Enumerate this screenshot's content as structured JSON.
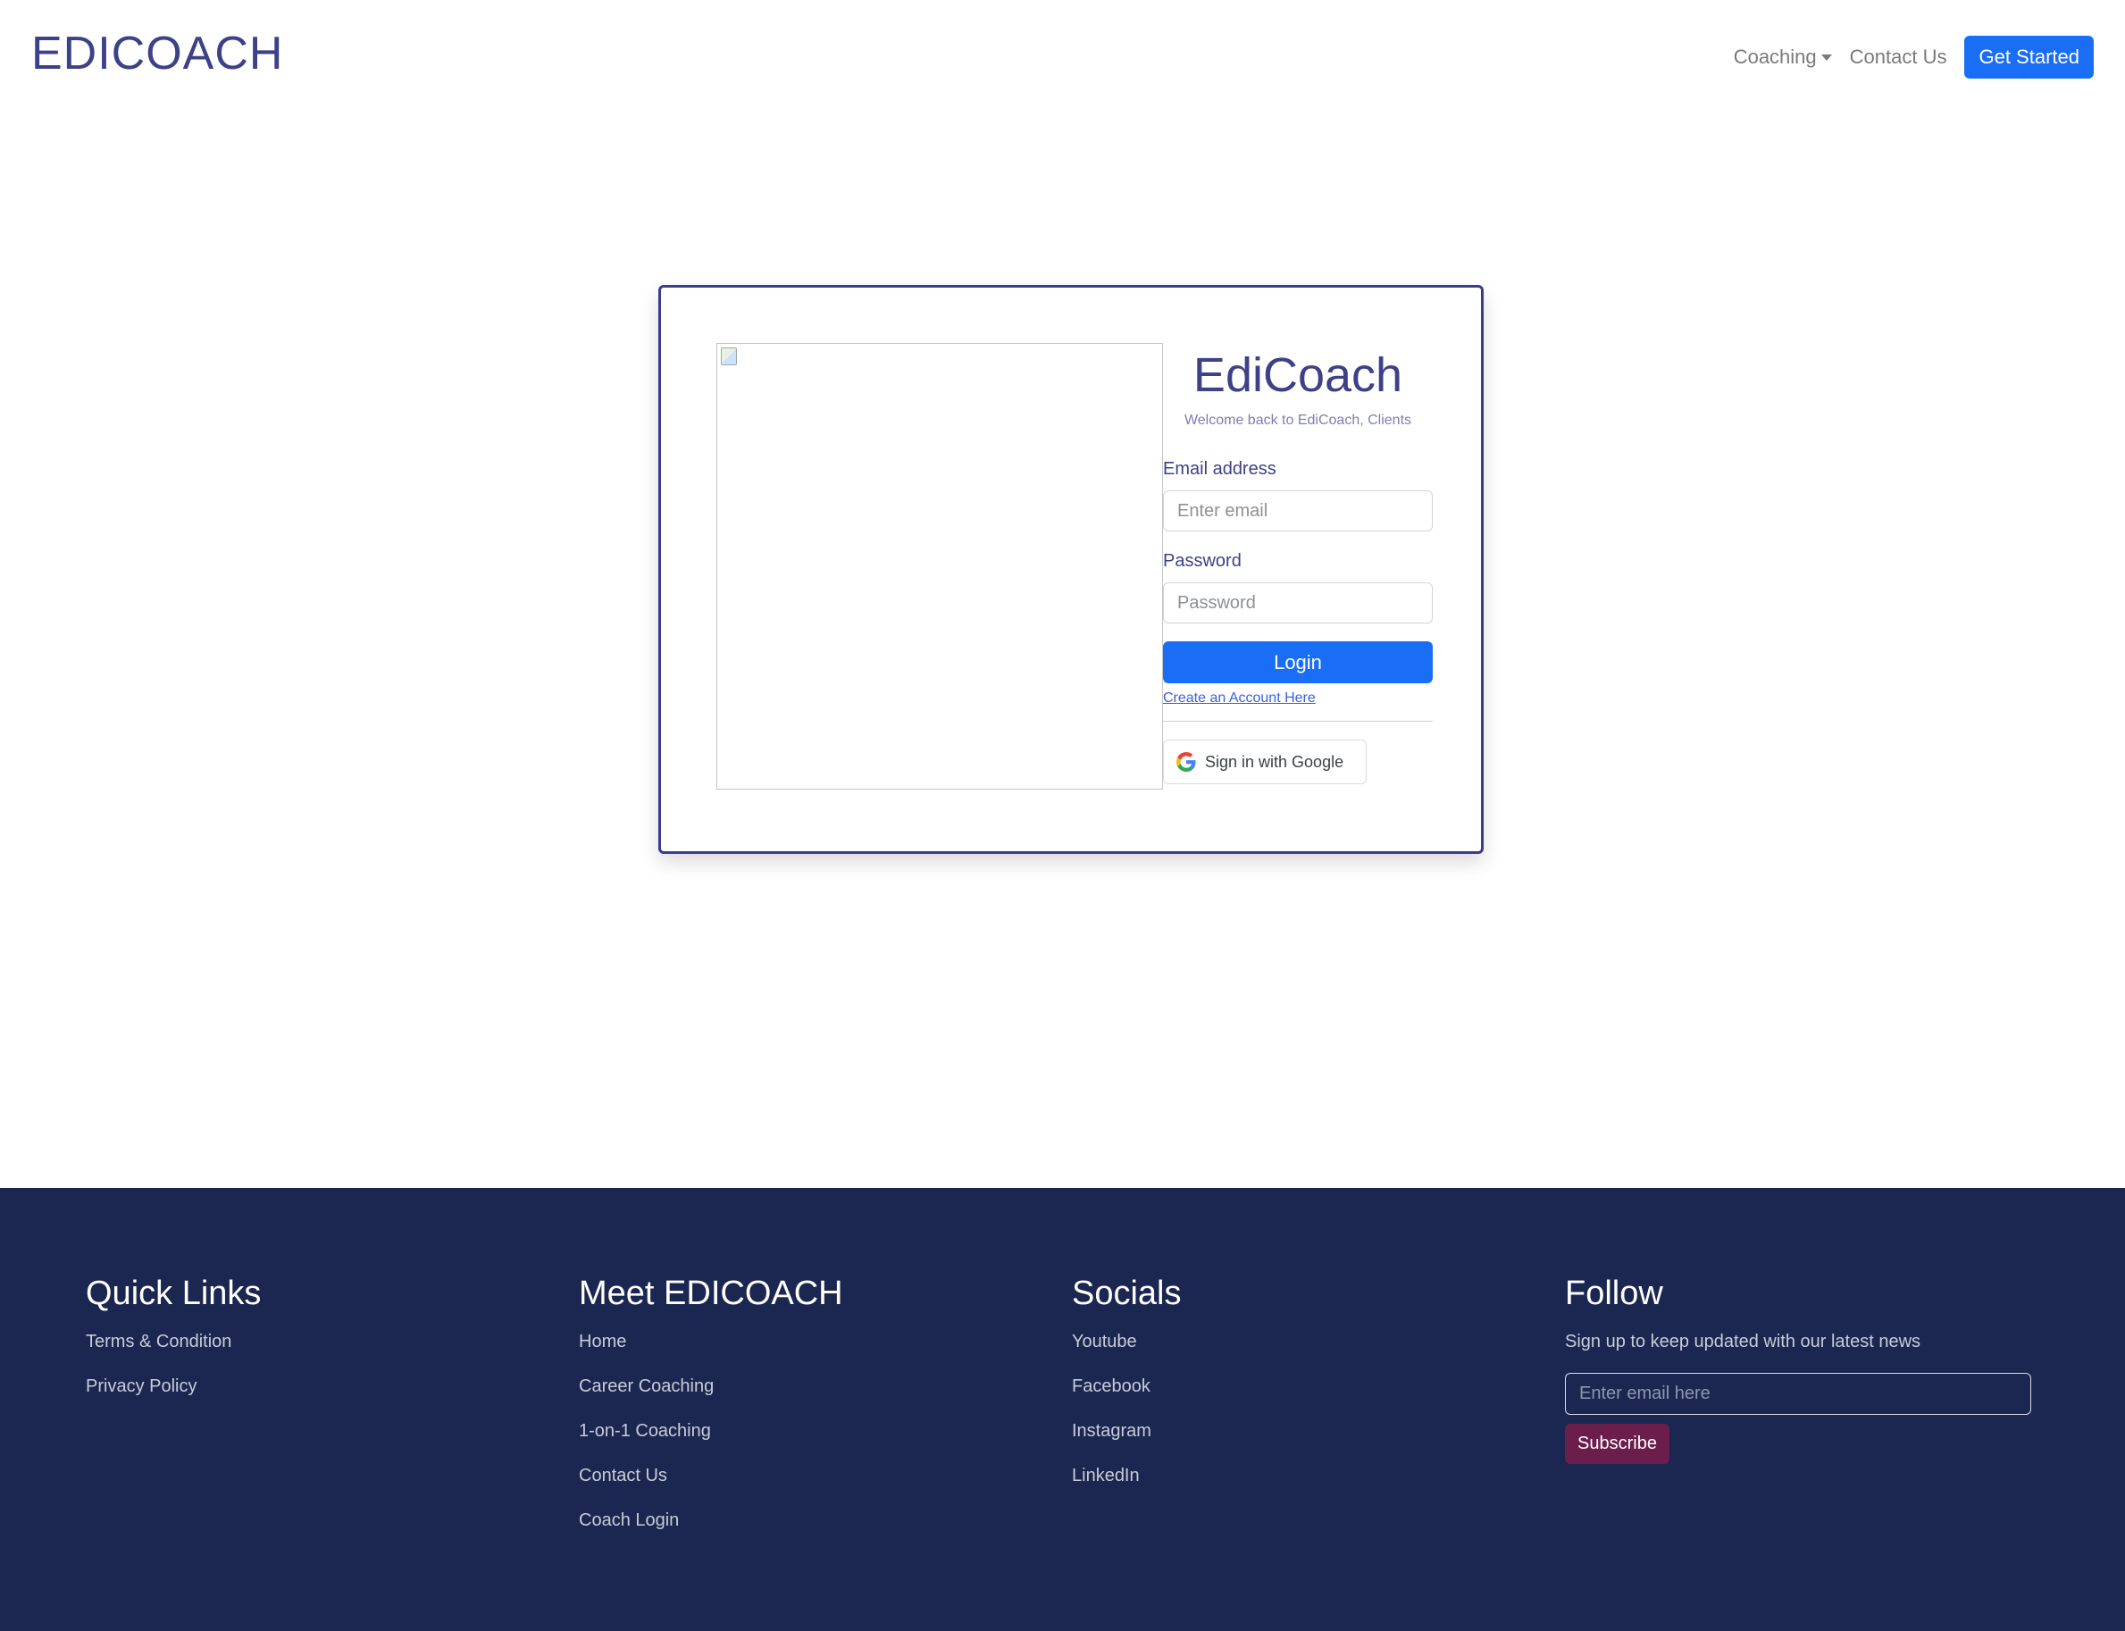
{
  "header": {
    "brand": "EDICOACH",
    "nav": {
      "coaching_label": "Coaching",
      "contact_label": "Contact Us",
      "cta_label": "Get Started"
    }
  },
  "login": {
    "title": "EdiCoach",
    "subtitle": "Welcome back to EdiCoach, Clients",
    "email_label": "Email address",
    "email_placeholder": "Enter email",
    "password_label": "Password",
    "password_placeholder": "Password",
    "login_button": "Login",
    "create_account_link": "Create an Account Here",
    "google_button": "Sign in with Google"
  },
  "footer": {
    "quick_links": {
      "title": "Quick Links",
      "items": [
        "Terms & Condition",
        "Privacy Policy"
      ]
    },
    "meet": {
      "title": "Meet EDICOACH",
      "items": [
        "Home",
        "Career Coaching",
        "1-on-1 Coaching",
        "Contact Us",
        "Coach Login"
      ]
    },
    "socials": {
      "title": "Socials",
      "items": [
        "Youtube",
        "Facebook",
        "Instagram",
        "LinkedIn"
      ]
    },
    "follow": {
      "title": "Follow",
      "text": "Sign up to keep updated with our latest news",
      "input_placeholder": "Enter email here",
      "button": "Subscribe"
    }
  },
  "colors": {
    "brand": "#3d4187",
    "primary": "#1a6ef5",
    "footer_bg": "#1b2750",
    "subscribe": "#6b1d4c"
  }
}
